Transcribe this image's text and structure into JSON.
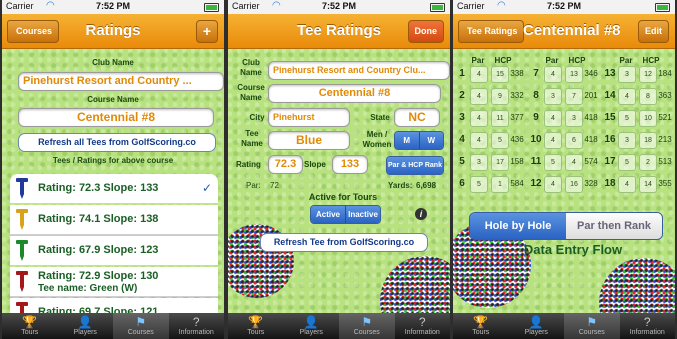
{
  "status": {
    "carrier": "Carrier",
    "time": "7:52 PM"
  },
  "screen1": {
    "title": "Ratings",
    "back_label": "Courses",
    "add_label": "+",
    "club_name_label": "Club Name",
    "club_name": "Pinehurst Resort and Country ...",
    "course_name_label": "Course Name",
    "course_name": "Centennial #8",
    "refresh_label": "Refresh all Tees from GolfScoring.co",
    "tees_heading": "Tees / Ratings for above course",
    "tees": [
      {
        "line1": "Rating: 72.3 Slope: 133",
        "line2": "",
        "color": "#1f3a9c",
        "checked": true
      },
      {
        "line1": "Rating: 74.1 Slope: 138",
        "line2": "",
        "color": "#d9a21c",
        "checked": false
      },
      {
        "line1": "Rating: 67.9 Slope: 123",
        "line2": "",
        "color": "#1a8a2a",
        "checked": false
      },
      {
        "line1": "Rating: 72.9 Slope: 130",
        "line2": "Tee name: Green (W)",
        "color": "#a31818",
        "checked": false
      },
      {
        "line1": "Rating: 69.7 Slope: 121",
        "line2": "",
        "color": "#a31818",
        "checked": false
      }
    ]
  },
  "screen2": {
    "title": "Tee Ratings",
    "done_label": "Done",
    "club_name_label": "Club Name",
    "club_name": "Pinehurst Resort and Country Clu...",
    "course_name_label": "Course Name",
    "course_name": "Centennial #8",
    "city_label": "City",
    "city": "Pinehurst",
    "state_label": "State",
    "state": "NC",
    "tee_name_label": "Tee Name",
    "tee_name": "Blue",
    "gender_label": "Men / Women",
    "gender_m": "M",
    "gender_w": "W",
    "rating_label": "Rating",
    "rating": "72.3",
    "slope_label": "Slope",
    "slope": "133",
    "par_hcp_rank_label": "Par & HCP Rank",
    "par_label": "Par:",
    "par": "72",
    "yards_label": "Yards:",
    "yards": "6,698",
    "active_heading": "Active for Tours",
    "active_label": "Active",
    "inactive_label": "Inactive",
    "refresh_label": "Refresh Tee from GolfScoring.co"
  },
  "screen3": {
    "title": "Centennial #8",
    "back_label": "Tee Ratings",
    "edit_label": "Edit",
    "col_par": "Par",
    "col_hcp": "HCP",
    "holes": [
      {
        "h": "1",
        "par": "4",
        "hcp": "15",
        "yd": "338",
        "h2": "7",
        "par2": "4",
        "hcp2": "13",
        "yd2": "346",
        "h3": "13",
        "par3": "3",
        "hcp3": "12",
        "yd3": "184"
      },
      {
        "h": "2",
        "par": "4",
        "hcp": "9",
        "yd": "332",
        "h2": "8",
        "par2": "3",
        "hcp2": "7",
        "yd2": "201",
        "h3": "14",
        "par3": "4",
        "hcp3": "8",
        "yd3": "363"
      },
      {
        "h": "3",
        "par": "4",
        "hcp": "11",
        "yd": "377",
        "h2": "9",
        "par2": "4",
        "hcp2": "3",
        "yd2": "418",
        "h3": "15",
        "par3": "5",
        "hcp3": "10",
        "yd3": "521"
      },
      {
        "h": "4",
        "par": "4",
        "hcp": "5",
        "yd": "436",
        "h2": "10",
        "par2": "4",
        "hcp2": "6",
        "yd2": "418",
        "h3": "16",
        "par3": "3",
        "hcp3": "18",
        "yd3": "213"
      },
      {
        "h": "5",
        "par": "3",
        "hcp": "17",
        "yd": "158",
        "h2": "11",
        "par2": "5",
        "hcp2": "4",
        "yd2": "574",
        "h3": "17",
        "par3": "5",
        "hcp3": "2",
        "yd3": "513"
      },
      {
        "h": "6",
        "par": "5",
        "hcp": "1",
        "yd": "584",
        "h2": "12",
        "par2": "4",
        "hcp2": "16",
        "yd2": "328",
        "h3": "18",
        "par3": "4",
        "hcp3": "14",
        "yd3": "355"
      }
    ],
    "seg_left": "Hole by Hole",
    "seg_right": "Par then Rank",
    "flow_title": "Data Entry Flow"
  },
  "tabs": [
    {
      "label": "Tours",
      "icon": "trophy-icon"
    },
    {
      "label": "Players",
      "icon": "person-icon"
    },
    {
      "label": "Courses",
      "icon": "flag-icon"
    },
    {
      "label": "Information",
      "icon": "question-icon"
    }
  ]
}
